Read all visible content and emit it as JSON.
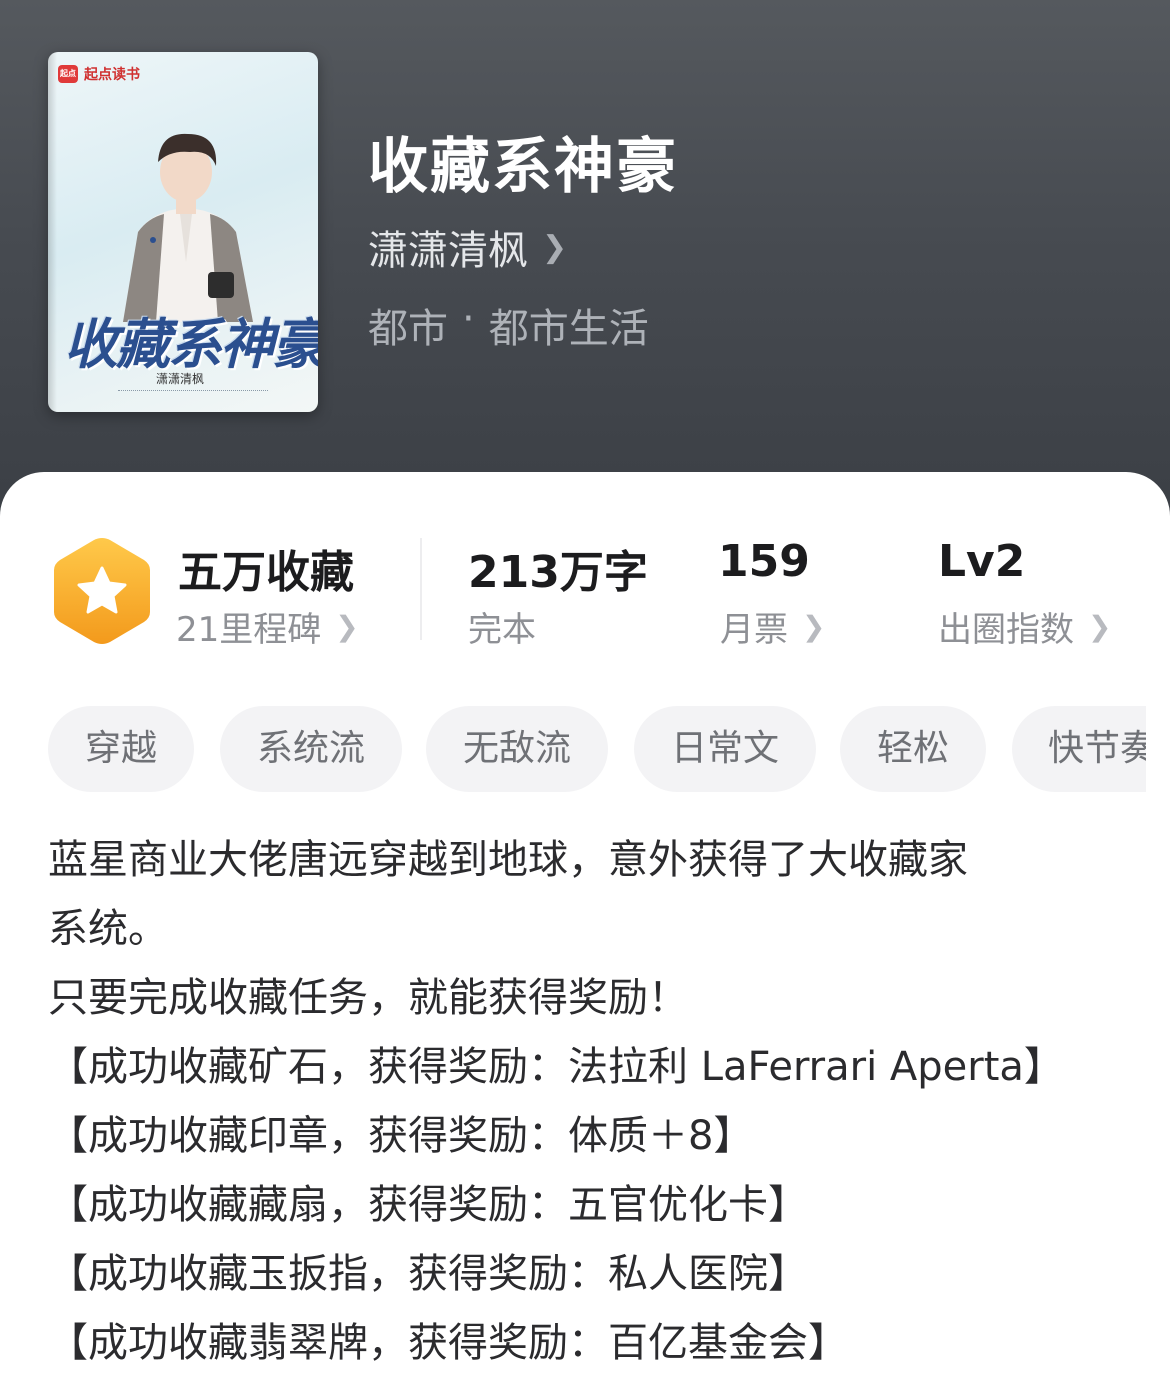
{
  "header": {
    "cover": {
      "logo_text": "起点读书",
      "title_art": "收藏系神豪",
      "author_art": "潇潇清枫"
    },
    "book_title": "收藏系神豪",
    "author": "潇潇清枫",
    "genre": "都市",
    "genre_sep": "·",
    "subgenre": "都市生活"
  },
  "stats": {
    "collection": {
      "title": "五万收藏",
      "sub": "21里程碑"
    },
    "words": {
      "value": "213万字",
      "sub": "完本"
    },
    "monthly_votes": {
      "value": "159",
      "sub": "月票"
    },
    "index": {
      "value": "Lv2",
      "sub": "出圈指数"
    }
  },
  "tags": [
    "穿越",
    "系统流",
    "无敌流",
    "日常文",
    "轻松",
    "快节奏"
  ],
  "synopsis": [
    "蓝星商业大佬唐远穿越到地球，意外获得了大收藏家",
    "系统。",
    "只要完成收藏任务，就能获得奖励！",
    "【成功收藏矿石，获得奖励：法拉利 LaFerrari Aperta】",
    "【成功收藏印章，获得奖励：体质＋8】",
    "【成功收藏藏扇，获得奖励：五官优化卡】",
    "【成功收藏玉扳指，获得奖励：私人医院】",
    "【成功收藏翡翠牌，获得奖励：百亿基金会】"
  ],
  "colors": {
    "header_bg": "#4b4f55",
    "badge_orange": "#f5a623",
    "text_primary": "#1c1c1e",
    "text_secondary": "#8e9095",
    "tag_bg": "#f3f3f5"
  },
  "icons": {
    "chevron": "chevron-right-icon",
    "badge": "star-hexagon-icon"
  }
}
